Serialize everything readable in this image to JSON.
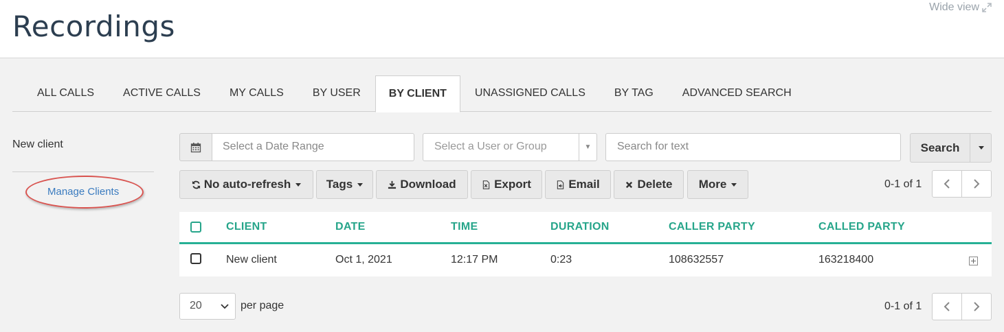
{
  "header": {
    "title": "Recordings",
    "wide_view_label": "Wide view"
  },
  "tabs": [
    {
      "label": "ALL CALLS",
      "active": false
    },
    {
      "label": "ACTIVE CALLS",
      "active": false
    },
    {
      "label": "MY CALLS",
      "active": false
    },
    {
      "label": "BY USER",
      "active": false
    },
    {
      "label": "BY CLIENT",
      "active": true
    },
    {
      "label": "UNASSIGNED CALLS",
      "active": false
    },
    {
      "label": "BY TAG",
      "active": false
    },
    {
      "label": "ADVANCED SEARCH",
      "active": false
    }
  ],
  "sidebar": {
    "title": "New client",
    "manage_link": "Manage Clients"
  },
  "filters": {
    "date_placeholder": "Select a Date Range",
    "user_placeholder": "Select a User or Group",
    "search_placeholder": "Search for text",
    "search_button": "Search"
  },
  "toolbar": {
    "refresh_label": "No auto-refresh",
    "tags_label": "Tags",
    "download_label": "Download",
    "export_label": "Export",
    "email_label": "Email",
    "delete_label": "Delete",
    "more_label": "More"
  },
  "pagination": {
    "range_text": "0-1 of 1",
    "per_page_value": "20",
    "per_page_label": "per page"
  },
  "table": {
    "columns": [
      "CLIENT",
      "DATE",
      "TIME",
      "DURATION",
      "CALLER PARTY",
      "CALLED PARTY"
    ],
    "rows": [
      {
        "client": "New client",
        "date": "Oct 1, 2021",
        "time": "12:17 PM",
        "duration": "0:23",
        "caller": "108632557",
        "called": "163218400"
      }
    ]
  },
  "colors": {
    "accent": "#26a58a",
    "link": "#3a7bbf",
    "highlight_ellipse": "#d9534f"
  }
}
